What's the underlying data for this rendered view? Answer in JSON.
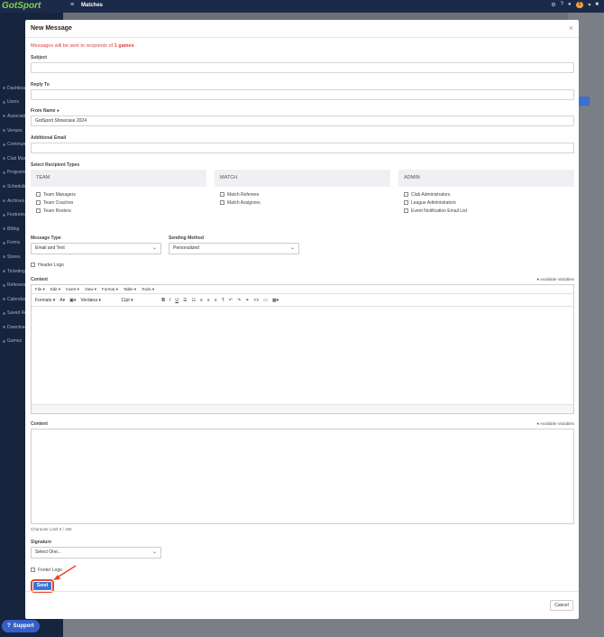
{
  "app": {
    "logo": "GotSport",
    "title": "Matches",
    "top_badge": "5"
  },
  "sidebar": {
    "items": [
      {
        "label": "Dashboard"
      },
      {
        "label": "Users"
      },
      {
        "label": "Associations"
      },
      {
        "label": "Venues"
      },
      {
        "label": "Communications"
      },
      {
        "label": "Club Management"
      },
      {
        "label": "Programs"
      },
      {
        "label": "Scheduling"
      },
      {
        "label": "Archives"
      },
      {
        "label": "Features"
      },
      {
        "label": "Billing"
      },
      {
        "label": "Forms"
      },
      {
        "label": "Stores"
      },
      {
        "label": "Ticketing"
      },
      {
        "label": "Referees"
      },
      {
        "label": "Calendar"
      },
      {
        "label": "Saved Reports"
      },
      {
        "label": "Downloads"
      },
      {
        "label": "Games"
      }
    ],
    "support_label": "Support"
  },
  "modal": {
    "title": "New Message",
    "notice_prefix": "Messages will be sent to recipients of ",
    "notice_count": "1 games",
    "subject_label": "Subject",
    "reply_to_label": "Reply To",
    "from_name_label": "From Name",
    "from_name_value": "GotSport Showcase 2024",
    "additional_email_label": "Additional Email",
    "recipient_types_label": "Select Recipient Types",
    "recipient_groups": [
      {
        "head": "TEAM",
        "options": [
          "Team Managers",
          "Team Coaches",
          "Team Rosters"
        ]
      },
      {
        "head": "MATCH",
        "options": [
          "Match Referees",
          "Match Assignors"
        ]
      },
      {
        "head": "ADMIN",
        "options": [
          "Club Administrators",
          "League Administrators",
          "Event Notification Email List"
        ]
      }
    ],
    "message_type_label": "Message Type",
    "message_type_value": "Email and Text",
    "sending_method_label": "Sending Method",
    "sending_method_value": "Personalized",
    "header_logo_label": "Header Logo",
    "content_label": "Content",
    "available_variables": "Available Variables",
    "editor_menu": [
      "File",
      "Edit",
      "Insert",
      "View",
      "Format",
      "Table",
      "Tools"
    ],
    "editor_formats": "Formats",
    "editor_font": "Verdana",
    "editor_size": "11pt",
    "content2_label": "Content",
    "available_variables2": "Available Variables",
    "char_limit": "Character Limit 0 / 160",
    "signature_label": "Signature",
    "signature_value": "Select One...",
    "footer_logo_label": "Footer Logo",
    "send_label": "Send",
    "cancel_label": "Cancel"
  },
  "colors": {
    "notice": "#e04040",
    "send_button": "#3a76d8",
    "highlight": "#e8452d"
  }
}
